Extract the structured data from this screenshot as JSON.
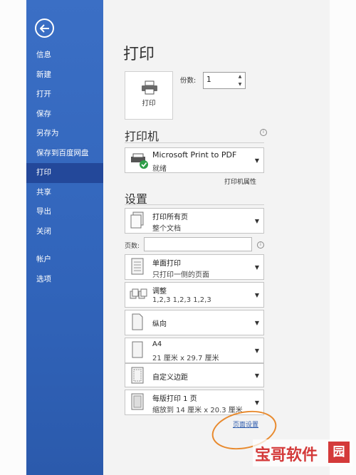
{
  "sidebar": {
    "items": [
      {
        "label": "信息"
      },
      {
        "label": "新建"
      },
      {
        "label": "打开"
      },
      {
        "label": "保存"
      },
      {
        "label": "另存为"
      },
      {
        "label": "保存到百度网盘"
      },
      {
        "label": "打印",
        "active": true
      },
      {
        "label": "共享"
      },
      {
        "label": "导出"
      },
      {
        "label": "关闭"
      },
      {
        "label": "帐户"
      },
      {
        "label": "选项"
      }
    ]
  },
  "main": {
    "title": "打印",
    "print_button_label": "打印",
    "copies_label": "份数:",
    "copies_value": "1",
    "printer_section_title": "打印机",
    "printer_name": "Microsoft Print to PDF",
    "printer_status": "就绪",
    "printer_properties_link": "打印机属性",
    "settings_section_title": "设置",
    "settings": [
      {
        "line1": "打印所有页",
        "line2": "整个文档",
        "icon": "pages-icon"
      },
      {
        "line1": "单面打印",
        "line2": "只打印一侧的页面",
        "icon": "single-sided-icon"
      },
      {
        "line1": "调整",
        "line2": "1,2,3    1,2,3    1,2,3",
        "icon": "collate-icon"
      },
      {
        "line1": "纵向",
        "line2": "",
        "icon": "portrait-icon"
      },
      {
        "line1": "A4",
        "line2": "21 厘米 x 29.7 厘米",
        "icon": "paper-size-icon"
      },
      {
        "line1": "自定义边距",
        "line2": "",
        "icon": "margins-icon"
      },
      {
        "line1": "每版打印 1 页",
        "line2": "缩放到 14 厘米 x 20.3 厘米",
        "icon": "pages-per-sheet-icon"
      }
    ],
    "pages_label": "页数:",
    "pages_value": "",
    "page_setup_link": "页面设置"
  },
  "watermark": {
    "text": "宝哥软件",
    "seal": "园"
  },
  "colors": {
    "sidebar": "#3164ba",
    "sidebar_active": "#23489a",
    "annotation": "#e88a2e",
    "watermark": "#d43a3a"
  }
}
